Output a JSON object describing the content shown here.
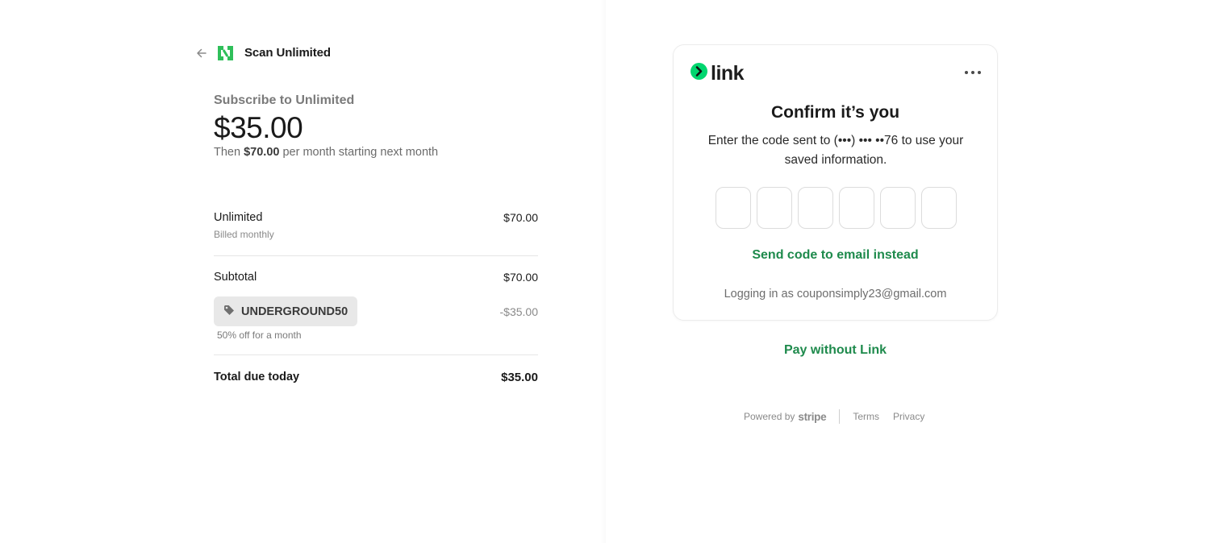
{
  "header": {
    "brand_name": "Scan Unlimited",
    "back_icon": "arrow-left-icon",
    "logo_icon": "scan-unlimited-logo",
    "brand_color": "#2fbf5a"
  },
  "summary": {
    "subscribe_label": "Subscribe to Unlimited",
    "price": "$35.00",
    "then_prefix": "Then ",
    "then_amount": "$70.00",
    "then_suffix": " per month starting next month"
  },
  "line_items": {
    "item_name": "Unlimited",
    "item_billing": "Billed monthly",
    "item_amount": "$70.00",
    "subtotal_label": "Subtotal",
    "subtotal_amount": "$70.00",
    "promo_code": "UNDERGROUND50",
    "promo_icon": "tag-icon",
    "promo_description": "50% off for a month",
    "discount_amount": "-$35.00",
    "total_label": "Total due today",
    "total_amount": "$35.00"
  },
  "link_card": {
    "logo_text": "link",
    "logo_color": "#00d66f",
    "more_icon": "more-horizontal-icon",
    "title": "Confirm it’s you",
    "description": "Enter the code sent to (•••) ••• ••76 to use your saved information.",
    "code_digits": [
      "",
      "",
      "",
      "",
      "",
      ""
    ],
    "send_email_label": "Send code to email instead",
    "logging_in_text": "Logging in as couponsimply23@gmail.com",
    "accent_color": "#1e8a4c"
  },
  "pay_without_link": "Pay without Link",
  "footer": {
    "powered_by": "Powered by",
    "stripe": "stripe",
    "terms": "Terms",
    "privacy": "Privacy"
  }
}
